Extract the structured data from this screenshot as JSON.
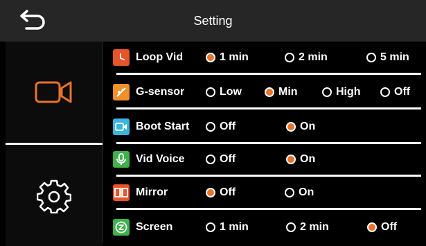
{
  "header": {
    "title": "Setting"
  },
  "sidebar": {
    "items": [
      {
        "name": "video",
        "icon": "video-camera-icon",
        "selected": true
      },
      {
        "name": "settings",
        "icon": "gear-icon",
        "selected": false
      }
    ]
  },
  "colors": {
    "accent": "#e8742b",
    "header_bg": "#262626",
    "background": "#000000"
  },
  "settings": {
    "loop_vid": {
      "label": "Loop Vid",
      "icon": "clock-icon",
      "icon_color": "#e8542b",
      "options": [
        "1 min",
        "2 min",
        "5 min"
      ],
      "selected": "1 min"
    },
    "g_sensor": {
      "label": "G-sensor",
      "icon": "g-sensor-icon",
      "icon_color": "#f0902a",
      "options": [
        "Low",
        "Min",
        "High",
        "Off"
      ],
      "selected": "Min"
    },
    "boot_start": {
      "label": "Boot Start",
      "icon": "boot-camera-icon",
      "icon_color": "#38b6e0",
      "options": [
        "Off",
        "On"
      ],
      "selected": "On"
    },
    "vid_voice": {
      "label": "Vid Voice",
      "icon": "microphone-icon",
      "icon_color": "#3db34a",
      "options": [
        "Off",
        "On"
      ],
      "selected": "On"
    },
    "mirror": {
      "label": "Mirror",
      "icon": "mirror-icon",
      "icon_color": "#e8542b",
      "options": [
        "Off",
        "On"
      ],
      "selected": "Off"
    },
    "screen": {
      "label": "Screen",
      "icon": "screen-timeout-icon",
      "icon_color": "#3db34a",
      "options": [
        "1 min",
        "2 min",
        "Off"
      ],
      "selected": "Off"
    }
  }
}
